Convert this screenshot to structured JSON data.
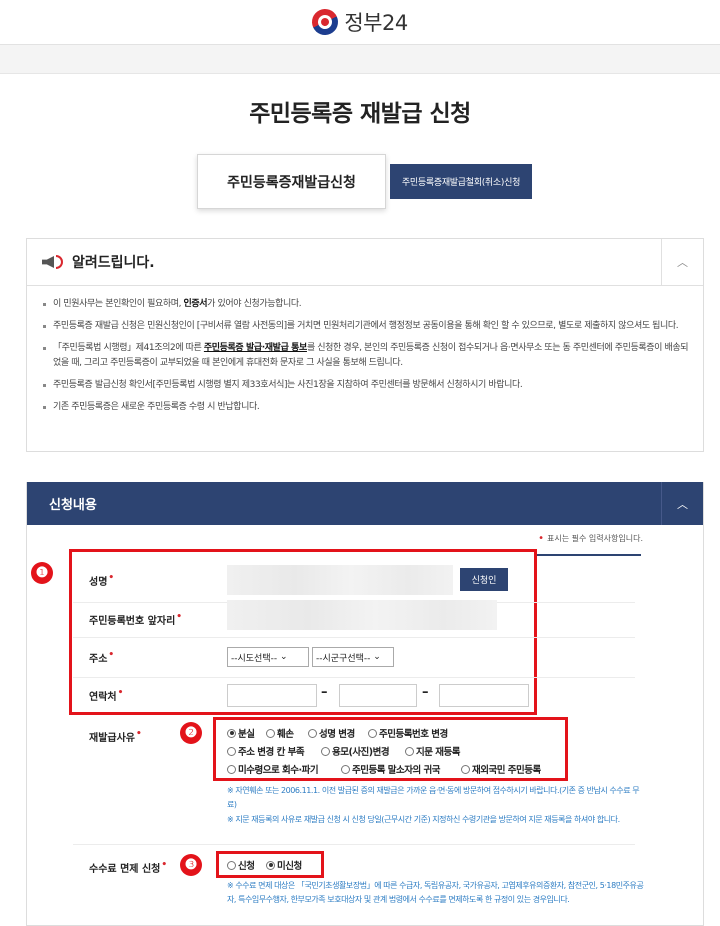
{
  "header": {
    "logo_text": "정부24"
  },
  "page_title": "주민등록증 재발급 신청",
  "tabs": {
    "active": "주민등록증재발급신청",
    "other": "주민등록증재발급철회(취소)신청"
  },
  "notice": {
    "title": "알려드립니다.",
    "toggle": "︿",
    "items": [
      {
        "a": "이 민원사무는 본인확인이 필요하며, ",
        "b": "인증서",
        "c": "가 있어야 신청가능합니다."
      },
      {
        "a": "주민등록증 재발급 신청은 민원신청인이 [구비서류 열람 사전동의]를 거치면 민원처리기관에서 행정정보 공동이용을 통해 확인 할 수 있으므로, 별도로 제출하지 않으셔도 됩니다."
      },
      {
        "a": "「주민등록법 시행령」제41조의2에 따른 ",
        "b": "주민등록증 발급·재발급 통보",
        "c": "를 신청한 경우, 본인의 주민등록증 신청이 접수되거나 읍·면사무소 또는 동 주민센터에 주민등록증이 배송되었을 때, 그리고 주민등록증이 교부되었을 때 본인에게 휴대전화 문자로 그 사실을 통보해 드립니다."
      },
      {
        "a": "주민등록증 발급신청 확인서[주민등록법 시행령 별지 제33호서식]는 사진1장을 지참하여 주민센터를 방문해서 신청하시기 바랍니다."
      },
      {
        "a": "기존 주민등록증은 새로운 주민등록증 수령 시 반납합니다."
      }
    ]
  },
  "section": {
    "title": "신청내용",
    "toggle": "︿",
    "required_note": "표시는 필수 입력사항입니다.",
    "labels": {
      "name": "성명",
      "rrn": "주민등록번호 앞자리",
      "address": "주소",
      "contact": "연락처",
      "reason": "재발급사유",
      "fee": "수수료 면제 신청"
    },
    "applicant_button": "신청인",
    "sido_select": "--시도선택--",
    "sigungu_select": "--시군구선택--",
    "dash": "–",
    "reasons": [
      {
        "label": "분실",
        "checked": true
      },
      {
        "label": "훼손",
        "checked": false
      },
      {
        "label": "성명 변경",
        "checked": false
      },
      {
        "label": "주민등록번호 변경",
        "checked": false
      },
      {
        "label": "주소 변경 칸 부족",
        "checked": false
      },
      {
        "label": "용모(사진)변경",
        "checked": false
      },
      {
        "label": "지문 재등록",
        "checked": false
      },
      {
        "label": "미수령으로 회수·파기",
        "checked": false
      },
      {
        "label": "주민등록 말소자의 귀국",
        "checked": false
      },
      {
        "label": "재외국민 주민등록",
        "checked": false
      }
    ],
    "reason_notes": [
      "※ 자연훼손 또는 2006.11.1. 이전 발급된 증의 재발급은 가까운 읍·면·동에 방문하여 접수하시기 바랍니다.(기존 증 반납시 수수료 무료)",
      "※ 지문 재등록의 사유로 재발급 신청 시 신청 당일(근무시간 기준) 지정하신 수령기관을 방문하여 지문 재등록을 하셔야 합니다."
    ],
    "fee_options": [
      {
        "label": "신청",
        "checked": false
      },
      {
        "label": "미신청",
        "checked": true
      }
    ],
    "fee_note": "※ 수수료 면제 대상은 「국민기초생활보장법」에 따른 수급자, 독립유공자, 국가유공자, 고엽제후유의증환자, 참전군인, 5·18민주유공자, 특수임무수행자, 한부모가족 보호대상자 및 관계 법령에서 수수료를 면제하도록 한 규정이 있는 경우입니다.",
    "badges": [
      "❶",
      "❷",
      "❸"
    ]
  }
}
